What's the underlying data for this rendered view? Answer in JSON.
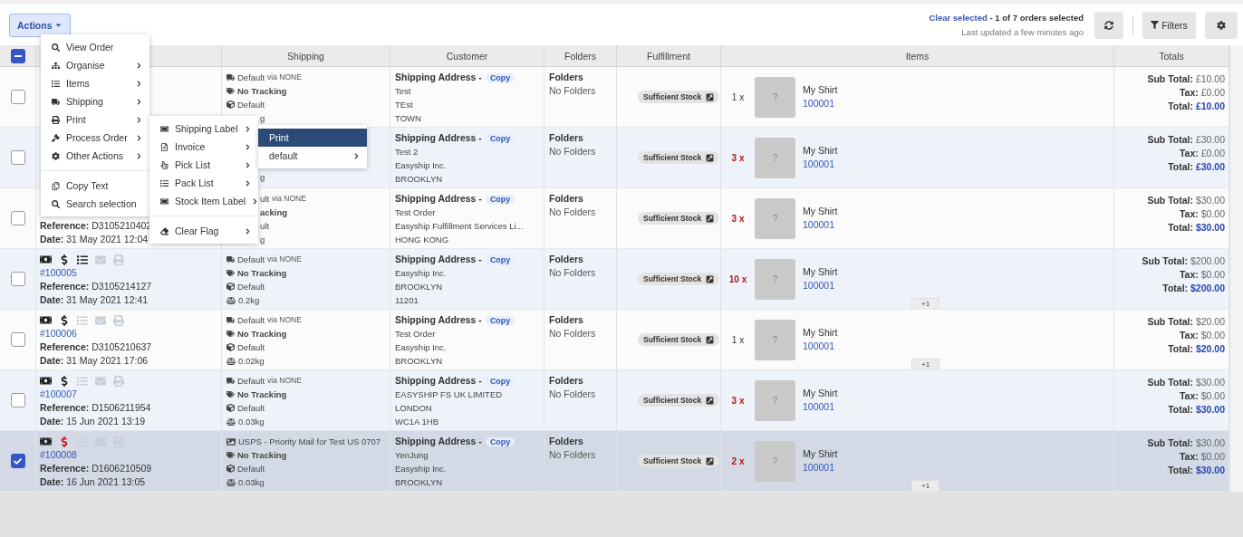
{
  "toolbar": {
    "actions_label": "Actions",
    "clear_selected": "Clear selected",
    "selection_summary": " - 1 of 7 orders selected",
    "last_updated": "Last updated a few minutes ago",
    "filters_label": "Filters"
  },
  "table": {
    "select_all": {
      "indeterminate": true
    },
    "columns": [
      "Shipping",
      "Customer",
      "Folders",
      "Fulfillment",
      "Items",
      "Totals"
    ],
    "rows": [
      {
        "checked": false,
        "shipping": [
          {
            "kind": "carrier",
            "text": "Default",
            "via": "via NONE"
          },
          {
            "kind": "tracking",
            "text": "No Tracking"
          },
          {
            "kind": "box",
            "text": "Default"
          },
          {
            "kind": "fragment",
            "text": "g"
          }
        ],
        "customer": {
          "heading": "Shipping Address -",
          "copy": "Copy",
          "lines": [
            "Test",
            "TEst",
            "TOWN"
          ]
        },
        "folders": {
          "heading": "Folders",
          "value": "No Folders"
        },
        "stock": "Sufficient Stock",
        "item": {
          "qty": "1 x",
          "warning": false,
          "image": "?",
          "name": "My Shirt",
          "sku": "100001"
        },
        "totals": [
          {
            "kind": "sub",
            "label": "Sub Total:",
            "value": "£10.00"
          },
          {
            "kind": "tax",
            "label": "Tax:",
            "value": "£0.00"
          },
          {
            "kind": "total",
            "label": "Total:",
            "value": "£10.00"
          }
        ]
      },
      {
        "checked": false,
        "shipping": [
          {
            "kind": "fragment",
            "text": "g"
          }
        ],
        "customer": {
          "heading": "Shipping Address -",
          "copy": "Copy",
          "lines": [
            "Test 2",
            "Easyship Inc.",
            "BROOKLYN"
          ]
        },
        "folders": {
          "heading": "Folders",
          "value": "No Folders"
        },
        "stock": "Sufficient Stock",
        "item": {
          "qty": "3 x",
          "warning": true,
          "image": "?",
          "name": "My Shirt",
          "sku": "100001"
        },
        "totals": [
          {
            "kind": "sub",
            "label": "Sub Total:",
            "value": "£30.00"
          },
          {
            "kind": "tax",
            "label": "Tax:",
            "value": "£0.00"
          },
          {
            "kind": "total",
            "label": "Total:",
            "value": "£30.00"
          }
        ]
      },
      {
        "checked": false,
        "order": {
          "reference_label": "Reference:",
          "reference": "D3105210402",
          "date_label": "Date:",
          "date": "31 May 2021 12:04"
        },
        "shipping": [
          {
            "kind": "fragment",
            "text": "ult",
            "via": "via NONE"
          },
          {
            "kind": "fragment",
            "text": "acking"
          },
          {
            "kind": "fragment",
            "text": "ult"
          },
          {
            "kind": "fragment",
            "text": "g"
          }
        ],
        "customer": {
          "heading": "Shipping Address -",
          "copy": "Copy",
          "lines": [
            "Test Order",
            "Easyship Fulfillment Services Li...",
            "HONG KONG"
          ]
        },
        "folders": {
          "heading": "Folders",
          "value": "No Folders"
        },
        "stock": "Sufficient Stock",
        "item": {
          "qty": "3 x",
          "warning": true,
          "image": "?",
          "name": "My Shirt",
          "sku": "100001"
        },
        "totals": [
          {
            "kind": "sub",
            "label": "Sub Total:",
            "value": "$30.00"
          },
          {
            "kind": "tax",
            "label": "Tax:",
            "value": "$0.00"
          },
          {
            "kind": "total",
            "label": "Total:",
            "value": "$30.00"
          }
        ]
      },
      {
        "checked": false,
        "order": {
          "items_ready": true,
          "payment_alert": false,
          "number": "#100005",
          "reference_label": "Reference:",
          "reference": "D3105214127",
          "date_label": "Date:",
          "date": "31 May 2021 12:41"
        },
        "shipping": [
          {
            "kind": "carrier",
            "text": "Default",
            "via": "via NONE"
          },
          {
            "kind": "tracking",
            "text": "No Tracking"
          },
          {
            "kind": "box",
            "text": "Default"
          },
          {
            "kind": "weight",
            "text": "0.2kg"
          }
        ],
        "customer": {
          "heading": "Shipping Address -",
          "copy": "Copy",
          "lines": [
            "Easyship Inc.",
            "BROOKLYN",
            "11201"
          ]
        },
        "folders": {
          "heading": "Folders",
          "value": "No Folders"
        },
        "stock": "Sufficient Stock",
        "item": {
          "qty": "10 x",
          "warning": true,
          "image": "?",
          "name": "My Shirt",
          "sku": "100001",
          "more": "+1"
        },
        "totals": [
          {
            "kind": "sub",
            "label": "Sub Total:",
            "value": "$200.00"
          },
          {
            "kind": "tax",
            "label": "Tax:",
            "value": "$0.00"
          },
          {
            "kind": "total",
            "label": "Total:",
            "value": "$200.00"
          }
        ]
      },
      {
        "checked": false,
        "order": {
          "items_ready": false,
          "payment_alert": false,
          "number": "#100006",
          "reference_label": "Reference:",
          "reference": "D3105210637",
          "date_label": "Date:",
          "date": "31 May 2021 17:06"
        },
        "shipping": [
          {
            "kind": "carrier",
            "text": "Default",
            "via": "via NONE"
          },
          {
            "kind": "tracking",
            "text": "No Tracking"
          },
          {
            "kind": "box",
            "text": "Default"
          },
          {
            "kind": "weight",
            "text": "0.02kg"
          }
        ],
        "customer": {
          "heading": "Shipping Address -",
          "copy": "Copy",
          "lines": [
            "Test Order",
            "Easyship Inc.",
            "BROOKLYN"
          ]
        },
        "folders": {
          "heading": "Folders",
          "value": "No Folders"
        },
        "stock": "Sufficient Stock",
        "item": {
          "qty": "1 x",
          "warning": false,
          "image": "?",
          "name": "My Shirt",
          "sku": "100001",
          "more": "+1"
        },
        "totals": [
          {
            "kind": "sub",
            "label": "Sub Total:",
            "value": "$20.00"
          },
          {
            "kind": "tax",
            "label": "Tax:",
            "value": "$0.00"
          },
          {
            "kind": "total",
            "label": "Total:",
            "value": "$20.00"
          }
        ]
      },
      {
        "checked": false,
        "order": {
          "items_ready": false,
          "payment_alert": false,
          "number": "#100007",
          "reference_label": "Reference:",
          "reference": "D1506211954",
          "date_label": "Date:",
          "date": "15 Jun 2021 13:19"
        },
        "shipping": [
          {
            "kind": "carrier",
            "text": "Default",
            "via": "via NONE"
          },
          {
            "kind": "tracking",
            "text": "No Tracking"
          },
          {
            "kind": "box",
            "text": "Default"
          },
          {
            "kind": "weight",
            "text": "0.03kg"
          }
        ],
        "customer": {
          "heading": "Shipping Address -",
          "copy": "Copy",
          "lines": [
            "EASYSHIP FS UK LIMITED",
            "LONDON",
            "WC1A 1HB"
          ]
        },
        "folders": {
          "heading": "Folders",
          "value": "No Folders"
        },
        "stock": "Sufficient Stock",
        "item": {
          "qty": "3 x",
          "warning": true,
          "image": "?",
          "name": "My Shirt",
          "sku": "100001"
        },
        "totals": [
          {
            "kind": "sub",
            "label": "Sub Total:",
            "value": "$30.00"
          },
          {
            "kind": "tax",
            "label": "Tax:",
            "value": "$0.00"
          },
          {
            "kind": "total",
            "label": "Total:",
            "value": "$30.00"
          }
        ]
      },
      {
        "checked": true,
        "order": {
          "items_ready": false,
          "payment_alert": true,
          "number": "#100008",
          "reference_label": "Reference:",
          "reference": "D1606210509",
          "date_label": "Date:",
          "date": "16 Jun 2021 13:05"
        },
        "shipping": [
          {
            "kind": "carrier_image",
            "text": "USPS - Priority Mail for Test US 0707"
          },
          {
            "kind": "tracking",
            "text": "No Tracking"
          },
          {
            "kind": "box",
            "text": "Default"
          },
          {
            "kind": "weight",
            "text": "0.03kg"
          }
        ],
        "customer": {
          "heading": "Shipping Address -",
          "copy": "Copy",
          "lines": [
            "YenJung",
            "Easyship Inc.",
            "BROOKLYN"
          ]
        },
        "folders": {
          "heading": "Folders",
          "value": "No Folders"
        },
        "stock": "Sufficient Stock",
        "item": {
          "qty": "2 x",
          "warning": true,
          "image": "?",
          "name": "My Shirt",
          "sku": "100001",
          "more": "+1"
        },
        "totals": [
          {
            "kind": "sub",
            "label": "Sub Total:",
            "value": "$30.00"
          },
          {
            "kind": "tax",
            "label": "Tax:",
            "value": "$0.00"
          },
          {
            "kind": "total",
            "label": "Total:",
            "value": "$30.00"
          }
        ]
      }
    ]
  },
  "menus": [
    {
      "groups": [
        [
          {
            "label": "View Order",
            "submenu": false,
            "selected": false
          },
          {
            "label": "Organise",
            "submenu": true,
            "selected": false
          },
          {
            "label": "Items",
            "submenu": true,
            "selected": false
          },
          {
            "label": "Shipping",
            "submenu": true,
            "selected": false
          },
          {
            "label": "Print",
            "submenu": true,
            "selected": false
          },
          {
            "label": "Process Order",
            "submenu": true,
            "selected": false
          },
          {
            "label": "Other Actions",
            "submenu": true,
            "selected": false
          }
        ],
        [
          {
            "label": "Copy Text",
            "submenu": false,
            "selected": false
          },
          {
            "label": "Search selection",
            "submenu": false,
            "selected": false
          }
        ]
      ]
    },
    {
      "groups": [
        [
          {
            "label": "Shipping Label",
            "submenu": true,
            "selected": false
          },
          {
            "label": "Invoice",
            "submenu": true,
            "selected": false
          },
          {
            "label": "Pick List",
            "submenu": true,
            "selected": false
          },
          {
            "label": "Pack List",
            "submenu": true,
            "selected": false
          },
          {
            "label": "Stock Item Label",
            "submenu": true,
            "selected": false
          }
        ],
        [
          {
            "label": "Clear Flag",
            "submenu": true,
            "selected": false
          }
        ]
      ]
    },
    {
      "groups": [
        [
          {
            "label": "Print",
            "submenu": false,
            "selected": true
          },
          {
            "label": "default",
            "submenu": true,
            "selected": false
          }
        ]
      ]
    }
  ]
}
